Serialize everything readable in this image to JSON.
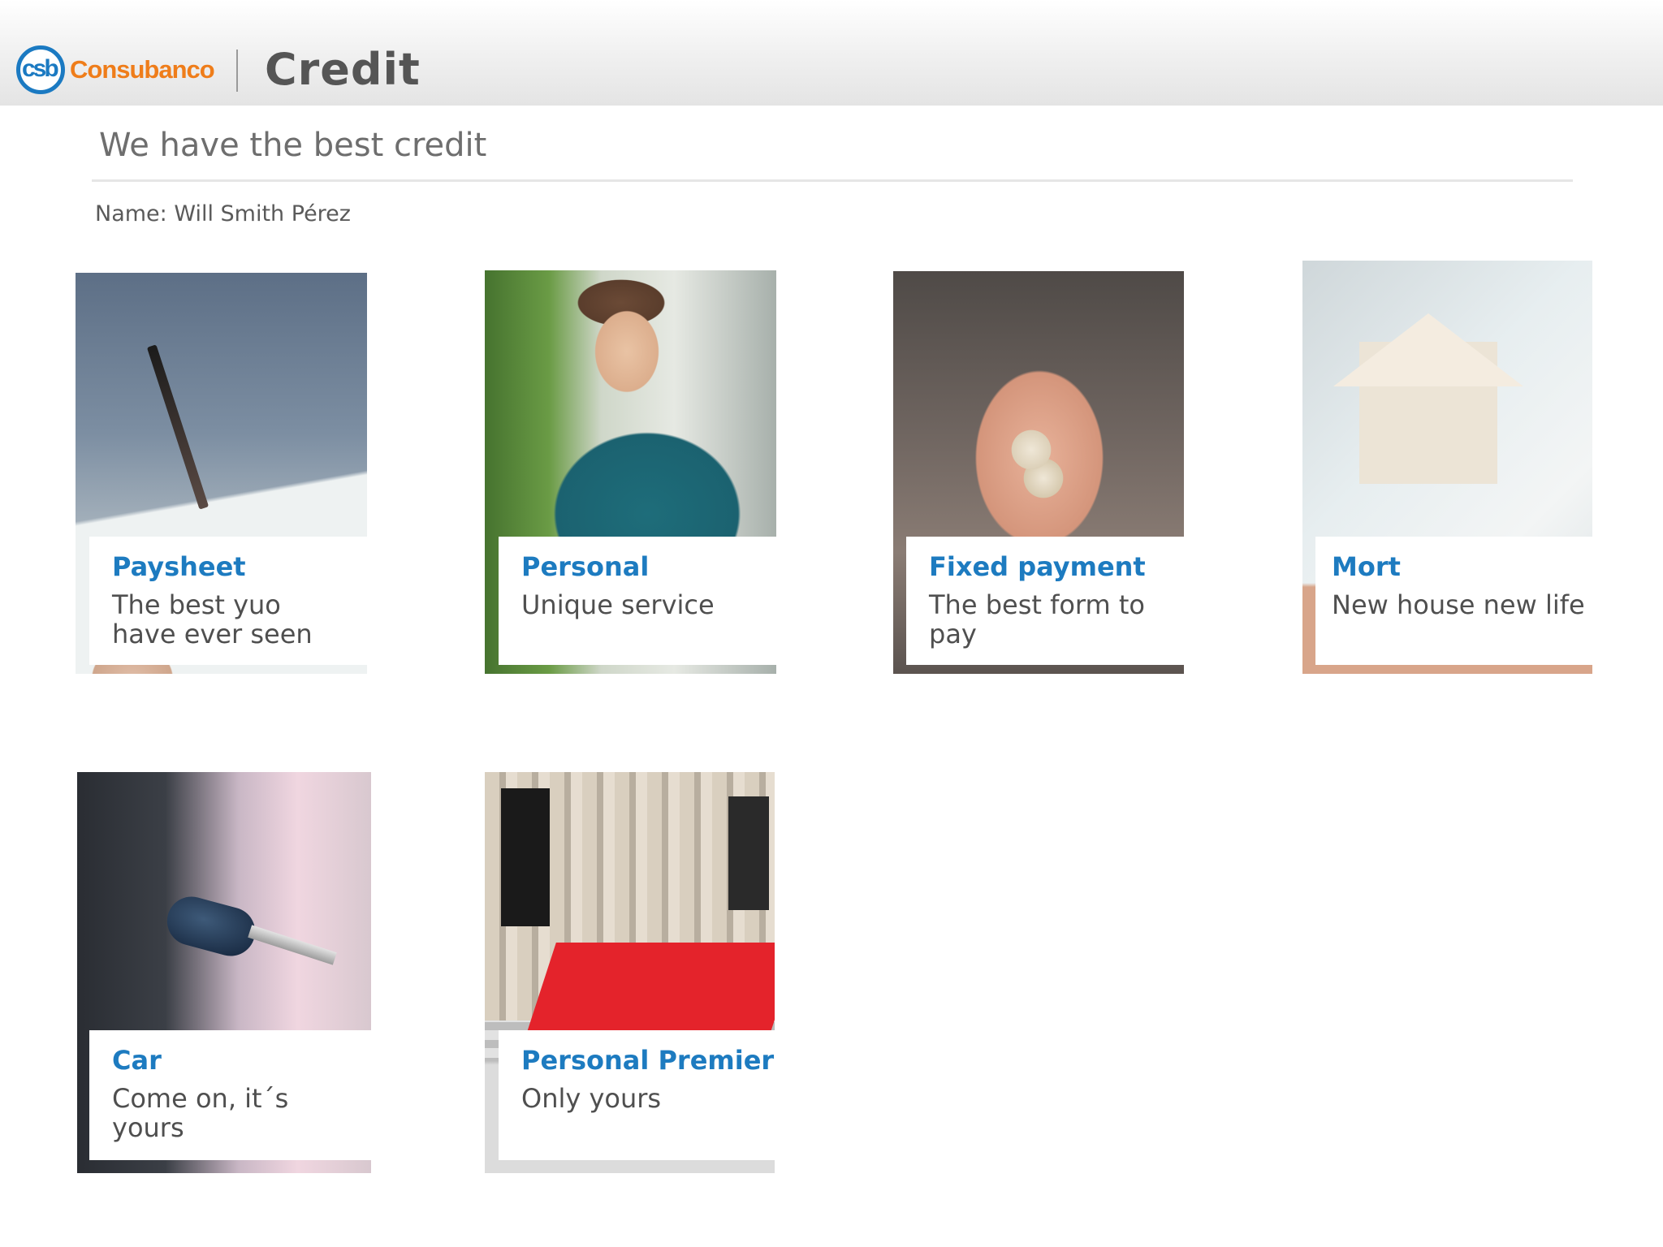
{
  "header": {
    "logo_monogram": "csb",
    "logo_name": "Consubanco",
    "title": "Credit"
  },
  "headline": "We have the best credit",
  "user_name": "Name: Will Smith Pérez",
  "colors": {
    "brand_blue": "#1d7bc0",
    "brand_orange": "#ef7d1a",
    "text_gray": "#4f4f4f"
  },
  "cards": [
    {
      "title": "Paysheet",
      "subtitle": "The best yuo have ever seen",
      "image": "signing-document-photo"
    },
    {
      "title": "Personal",
      "subtitle": "Unique service",
      "image": "woman-with-phone-photo"
    },
    {
      "title": "Fixed payment",
      "subtitle": "The best form to pay",
      "image": "coins-in-hand-photo"
    },
    {
      "title": "Mort",
      "subtitle": "New house new life",
      "image": "house-model-photo"
    },
    {
      "title": "Car",
      "subtitle": "Come on, it´s yours",
      "image": "car-key-photo"
    },
    {
      "title": "Personal Premiere",
      "subtitle": "Only yours",
      "image": "red-carpet-stairs-photo"
    }
  ]
}
